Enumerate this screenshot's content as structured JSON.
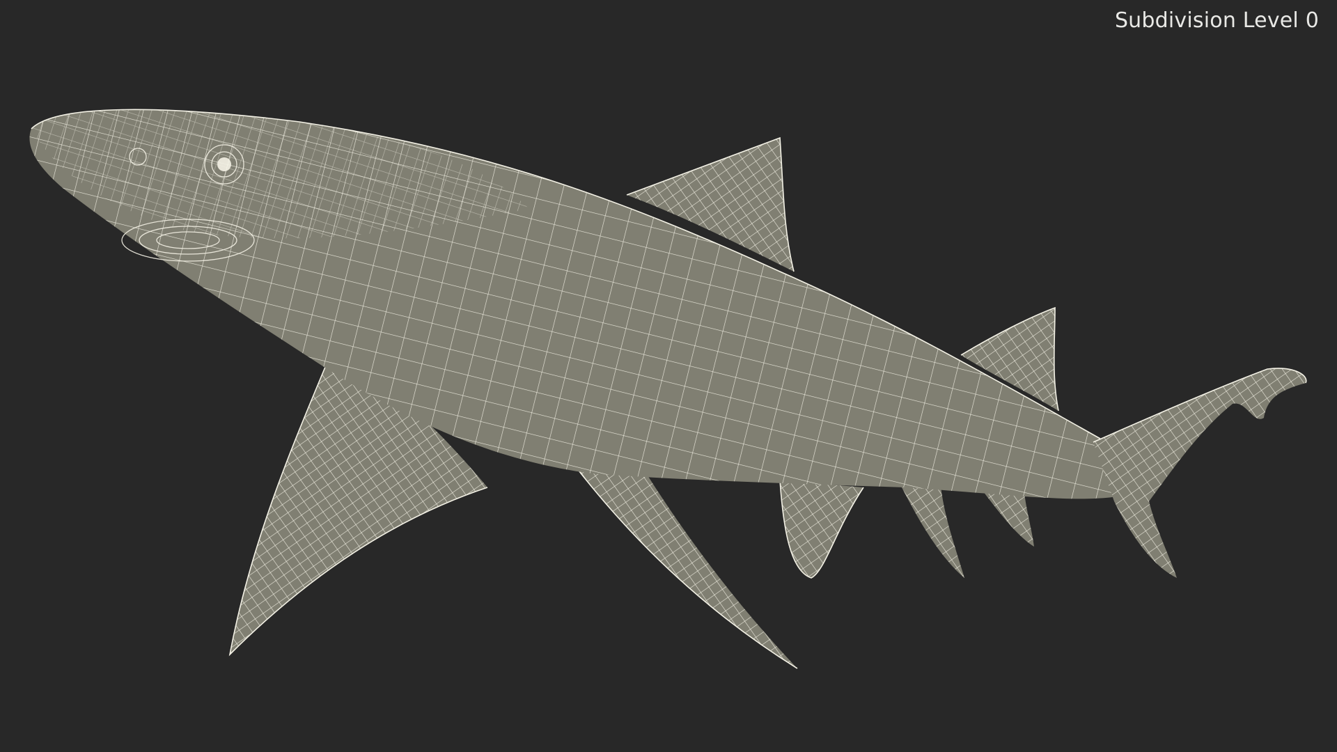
{
  "viewport": {
    "label": "Subdivision Level 0"
  },
  "colors": {
    "background": "#282828",
    "surface": "#807f72",
    "wireframe": "#f4f2e6"
  }
}
